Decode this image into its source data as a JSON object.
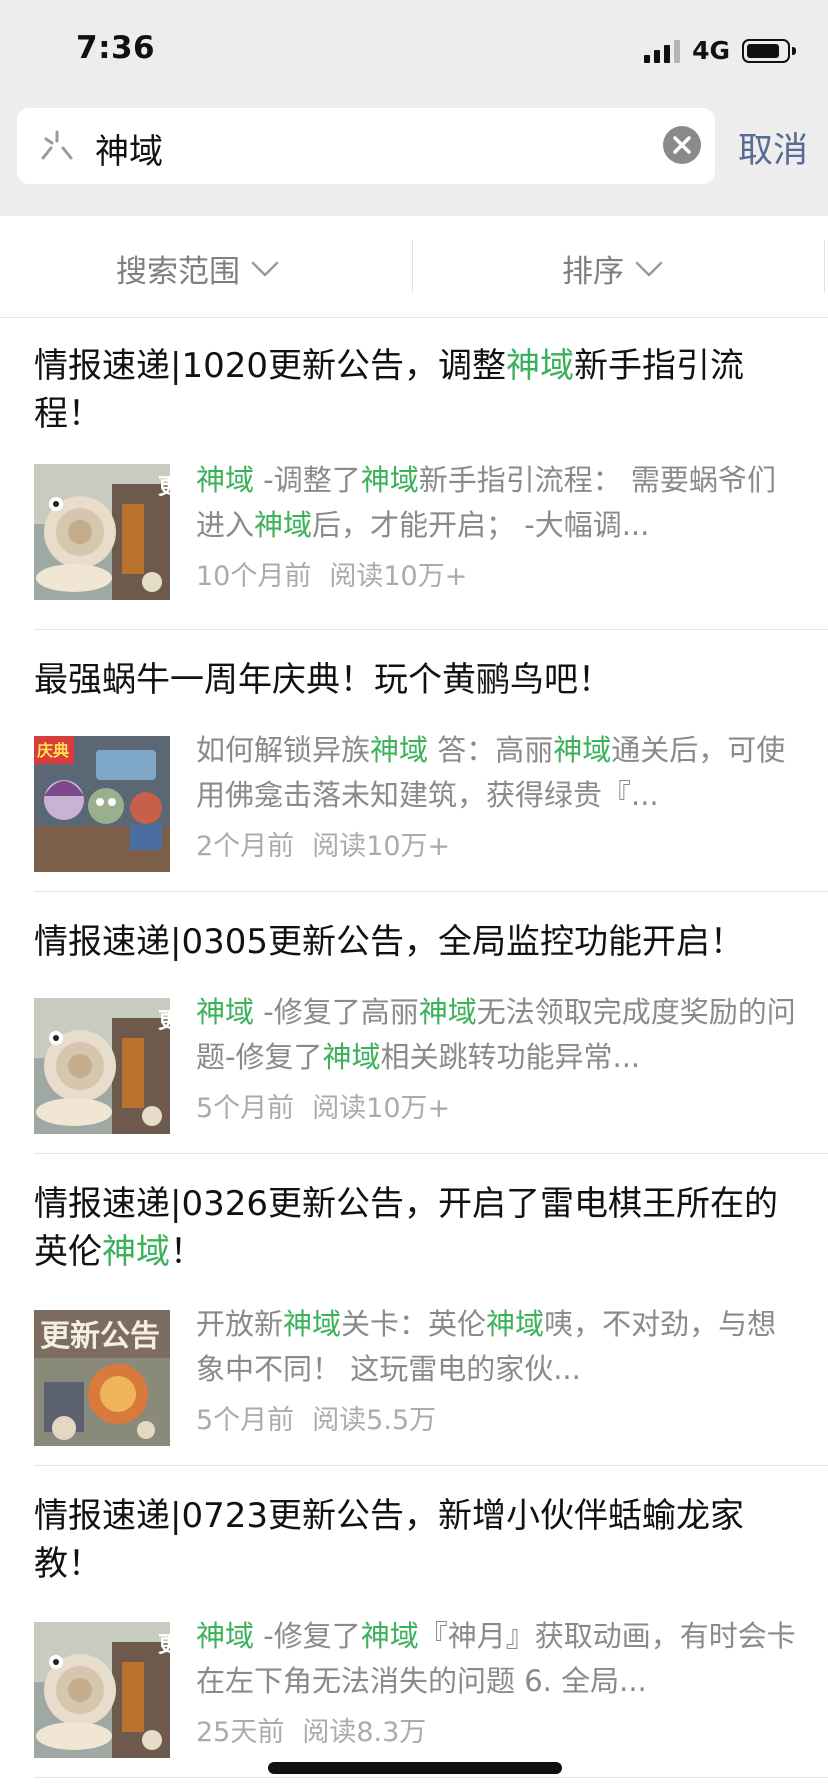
{
  "status_bar": {
    "time": "7:36",
    "network": "4G"
  },
  "search": {
    "query": "神域",
    "cancel_label": "取消"
  },
  "filters": [
    {
      "label": "搜索范围"
    },
    {
      "label": "排序"
    }
  ],
  "results": [
    {
      "title": [
        {
          "t": "情报速递|1020更新公告，调整"
        },
        {
          "t": "神域",
          "hl": true
        },
        {
          "t": "新手指引流程！"
        }
      ],
      "snippet": [
        {
          "t": "神域",
          "hl": true
        },
        {
          "t": " -调整了"
        },
        {
          "t": "神域",
          "hl": true
        },
        {
          "t": "新手指引流程： 需要蜗爷们进入"
        },
        {
          "t": "神域",
          "hl": true
        },
        {
          "t": "后，才能开启； -大幅调..."
        }
      ],
      "time": "10个月前",
      "reads": "阅读10万+",
      "thumb": "snail"
    },
    {
      "title": [
        {
          "t": "最强蜗牛一周年庆典！玩个黄鹂鸟吧！"
        }
      ],
      "snippet": [
        {
          "t": "如何解锁异族"
        },
        {
          "t": "神域",
          "hl": true
        },
        {
          "t": " 答：高丽"
        },
        {
          "t": "神域",
          "hl": true
        },
        {
          "t": "通关后，可使用佛龛击落未知建筑，获得绿贵『..."
        }
      ],
      "time": "2个月前",
      "reads": "阅读10万+",
      "thumb": "party"
    },
    {
      "title": [
        {
          "t": "情报速递|0305更新公告，全局监控功能开启！"
        }
      ],
      "snippet": [
        {
          "t": "神域",
          "hl": true
        },
        {
          "t": " -修复了高丽"
        },
        {
          "t": "神域",
          "hl": true
        },
        {
          "t": "无法领取完成度奖励的问题-修复了"
        },
        {
          "t": "神域",
          "hl": true
        },
        {
          "t": "相关跳转功能异常..."
        }
      ],
      "time": "5个月前",
      "reads": "阅读10万+",
      "thumb": "snail"
    },
    {
      "title": [
        {
          "t": "情报速递|0326更新公告，开启了雷电棋王所在的英伦"
        },
        {
          "t": "神域",
          "hl": true
        },
        {
          "t": "！"
        }
      ],
      "snippet": [
        {
          "t": "开放新"
        },
        {
          "t": "神域",
          "hl": true
        },
        {
          "t": "关卡：英伦"
        },
        {
          "t": "神域",
          "hl": true
        },
        {
          "t": "咦，不对劲，与想象中不同！ 这玩雷电的家伙..."
        }
      ],
      "time": "5个月前",
      "reads": "阅读5.5万",
      "thumb": "news",
      "thumb_text": "更新公告"
    },
    {
      "title": [
        {
          "t": "情报速递|0723更新公告，新增小伙伴蛞蝓龙家教！"
        }
      ],
      "snippet": [
        {
          "t": "神域",
          "hl": true
        },
        {
          "t": " -修复了"
        },
        {
          "t": "神域",
          "hl": true
        },
        {
          "t": "『神月』获取动画，有时会卡在左下角无法消失的问题 6. 全局..."
        }
      ],
      "time": "25天前",
      "reads": "阅读8.3万",
      "thumb": "snail"
    }
  ],
  "colors": {
    "highlight": "#3bb15a",
    "link": "#576b95",
    "topbar_bg": "#ededed"
  },
  "icons": {
    "search": "search-icon",
    "clear": "clear-icon",
    "dropdown": "chevron-down-icon"
  }
}
